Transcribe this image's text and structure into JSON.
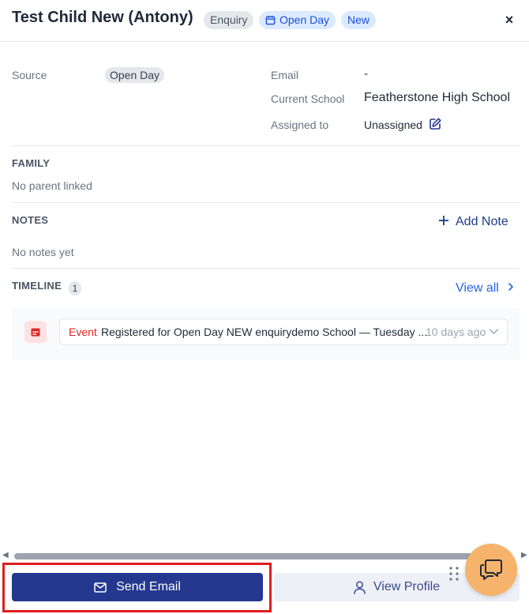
{
  "header": {
    "title": "Test Child New (Antony)",
    "badges": [
      "Enquiry",
      "Open Day",
      "New"
    ],
    "close_label": "×"
  },
  "details": {
    "source_label": "Source",
    "source_value": "Open Day",
    "email_label": "Email",
    "email_value": "-",
    "school_label": "Current School",
    "school_value": "Featherstone High School",
    "assigned_label": "Assigned to",
    "assigned_value": "Unassigned"
  },
  "family": {
    "heading": "FAMILY",
    "empty_text": "No parent linked"
  },
  "notes": {
    "heading": "NOTES",
    "add_label": "Add Note",
    "empty_text": "No notes yet"
  },
  "timeline": {
    "heading": "TIMELINE",
    "count": "1",
    "view_all_label": "View all",
    "items": [
      {
        "type": "Event",
        "text": "Registered for Open Day NEW enquirydemo School — Tuesday ...",
        "time": "10 days ago"
      }
    ]
  },
  "footer": {
    "send_email_label": "Send Email",
    "view_profile_label": "View Profile"
  },
  "colors": {
    "primary": "#24388f",
    "event_red": "#dc2626",
    "highlight": "#e11d1d",
    "chat_fab": "#f5b36b"
  },
  "icons": [
    "calendar-icon",
    "close-icon",
    "edit-icon",
    "plus-icon",
    "chevron-right-icon",
    "event-calendar-icon",
    "chevron-down-icon",
    "mail-icon",
    "user-icon",
    "drag-grip-icon",
    "chat-icon"
  ]
}
